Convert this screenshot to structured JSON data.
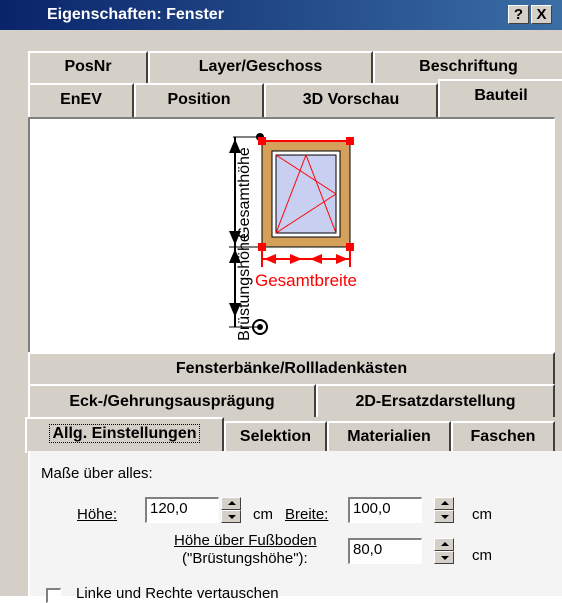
{
  "window": {
    "title": "Eigenschaften: Fenster",
    "help_glyph": "?",
    "close_glyph": "X"
  },
  "tabs_row1": [
    "PosNr",
    "Layer/Geschoss",
    "Beschriftung"
  ],
  "tabs_row2": [
    "EnEV",
    "Position",
    "3D Vorschau",
    "Bauteil"
  ],
  "preview": {
    "label_gesamthoehe": "Gesamthöhe",
    "label_gesamtbreite": "Gesamtbreite",
    "label_bruestungshoehe": "Brüstungshöhe",
    "colors": {
      "frame": "#d4a05a",
      "glass": "#c8cff0",
      "dimension": "#ff0000"
    }
  },
  "tabs_lower": {
    "row1": [
      "Fensterbänke/Rollladenkästen"
    ],
    "row2": [
      "Eck-/Gehrungsausprägung",
      "2D-Ersatzdarstellung"
    ],
    "row3": [
      "Allg. Einstellungen",
      "Selektion",
      "Materialien",
      "Faschen"
    ]
  },
  "settings": {
    "section_label": "Maße über alles:",
    "hoehe_label": "Höhe:",
    "hoehe_value": "120,0",
    "hoehe_unit": "cm",
    "breite_label": "Breite:",
    "breite_value": "100,0",
    "breite_unit": "cm",
    "hueb_label_line1": "Höhe über Fußboden",
    "hueb_label_line2": "(\"Brüstungshöhe\"):",
    "hueb_value": "80,0",
    "hueb_unit": "cm",
    "swap_checkbox_label": "Linke und Rechte vertauschen"
  }
}
